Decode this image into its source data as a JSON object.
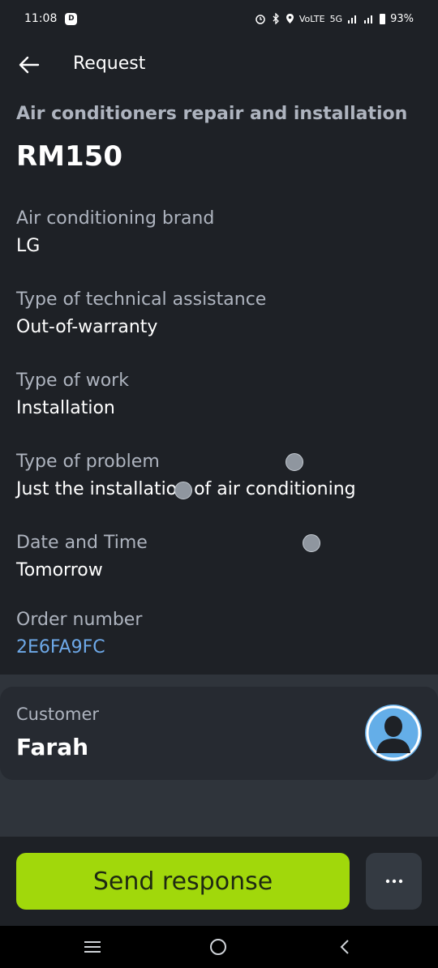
{
  "status_bar": {
    "time": "11:08",
    "badge": "D",
    "network": "5G",
    "volte": "VoLTE",
    "battery": "93%"
  },
  "app_bar": {
    "title": "Request"
  },
  "request": {
    "service": "Air conditioners repair and installation",
    "price": "RM150",
    "fields": [
      {
        "label": "Air conditioning brand",
        "value": "LG"
      },
      {
        "label": "Type of technical assistance",
        "value": "Out-of-warranty"
      },
      {
        "label": "Type of work",
        "value": "Installation"
      },
      {
        "label": "Type of problem",
        "value": "Just the installation of air conditioning"
      },
      {
        "label": "Date and Time",
        "value": "Tomorrow"
      },
      {
        "label": "Order number",
        "value": "2E6FA9FC"
      }
    ]
  },
  "customer": {
    "label": "Customer",
    "name": "Farah"
  },
  "actions": {
    "send_label": "Send response",
    "more_icon": "more-horizontal-icon"
  },
  "colors": {
    "background": "#1e2126",
    "accent_button": "#a1d80b",
    "link": "#6ea9e8",
    "label": "#aeb4bf",
    "avatar": "#64aee8"
  }
}
